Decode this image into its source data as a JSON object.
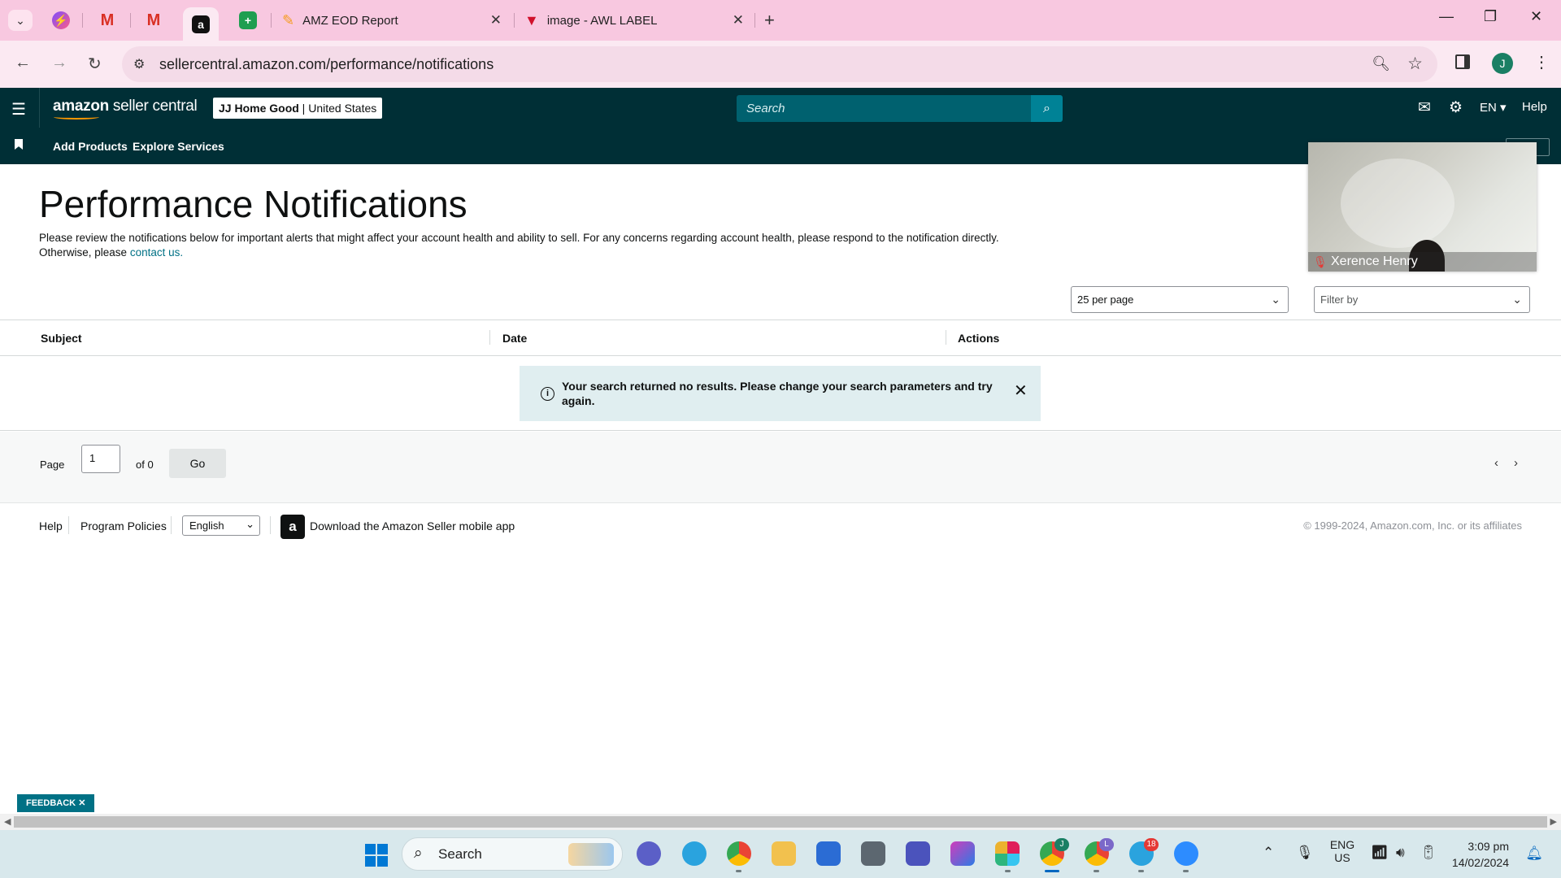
{
  "browser": {
    "tabs": [
      {
        "label": "AMZ EOD Report"
      },
      {
        "label": "image - AWL LABEL"
      }
    ],
    "url": "sellercentral.amazon.com/performance/notifications",
    "profile_initial": "J"
  },
  "header": {
    "logo_amazon": "amazon",
    "logo_rest": " seller central",
    "store_name": "JJ Home Good",
    "store_sep": " | ",
    "store_region": "United States",
    "search_placeholder": "Search",
    "lang": "EN",
    "help": "Help"
  },
  "subnav": {
    "items": [
      "Add Products",
      "Explore Services"
    ]
  },
  "video": {
    "participant": "Xerence Henry"
  },
  "main": {
    "title": "Performance Notifications",
    "intro": "Please review the notifications below for important alerts that might affect your account health and ability to sell. For any concerns regarding account health, please respond to the notification directly. Otherwise, please ",
    "intro_link": "contact us.",
    "per_page": "25 per page",
    "filter_placeholder": "Filter by",
    "columns": [
      "Subject",
      "Date",
      "Actions"
    ],
    "alert": "Your search returned no results. Please change your search parameters and try again."
  },
  "pager": {
    "page_label": "Page",
    "page_value": "1",
    "of_label": "of 0",
    "go": "Go"
  },
  "footer": {
    "help": "Help",
    "policies": "Program Policies",
    "language": "English",
    "app": "Download the Amazon Seller mobile app",
    "copyright": "© 1999-2024, Amazon.com, Inc. or its affiliates"
  },
  "feedback": "FEEDBACK",
  "taskbar": {
    "search": "Search",
    "lang_top": "ENG",
    "lang_bottom": "US",
    "time": "3:09 pm",
    "date": "14/02/2024",
    "telegram_badge": "18",
    "chrome_initial_1": "J",
    "chrome_initial_2": "L"
  }
}
